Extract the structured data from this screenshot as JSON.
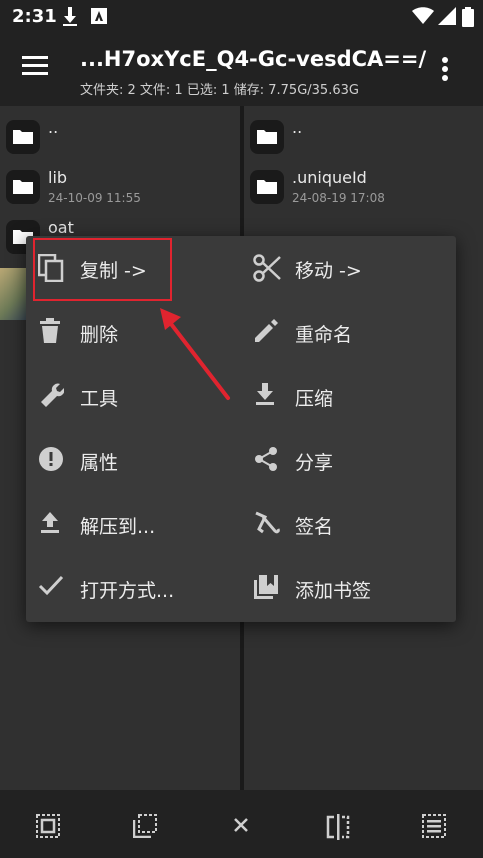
{
  "status_bar": {
    "time": "2:31",
    "icons": [
      "download-icon",
      "app-notification-icon",
      "wifi-icon",
      "signal-icon",
      "battery-icon"
    ]
  },
  "app_bar": {
    "title": "...H7oxYcE_Q4-Gc-vesdCA==/",
    "subtitle": "文件夹: 2  文件: 1  已选: 1  储存: 7.75G/35.63G",
    "icons": [
      "menu-icon",
      "more-vert-icon"
    ]
  },
  "left_pane": {
    "items": [
      {
        "name": "..",
        "date": ""
      },
      {
        "name": "lib",
        "date": "24-10-09 11:55"
      },
      {
        "name": "oat",
        "date": ""
      }
    ]
  },
  "right_pane": {
    "items": [
      {
        "name": "..",
        "date": ""
      },
      {
        "name": ".uniqueId",
        "date": "24-08-19 17:08"
      }
    ]
  },
  "context_menu": {
    "left": [
      {
        "label": "复制 ->",
        "icon": "copy-icon"
      },
      {
        "label": "删除",
        "icon": "delete-icon"
      },
      {
        "label": "工具",
        "icon": "wrench-icon"
      },
      {
        "label": "属性",
        "icon": "info-icon"
      },
      {
        "label": "解压到...",
        "icon": "upload-icon"
      },
      {
        "label": "打开方式...",
        "icon": "check-icon"
      }
    ],
    "right": [
      {
        "label": "移动 ->",
        "icon": "cut-icon"
      },
      {
        "label": "重命名",
        "icon": "edit-icon"
      },
      {
        "label": "压缩",
        "icon": "download-icon"
      },
      {
        "label": "分享",
        "icon": "share-icon"
      },
      {
        "label": "签名",
        "icon": "signature-icon"
      },
      {
        "label": "添加书签",
        "icon": "bookmark-icon"
      }
    ]
  },
  "bottom_bar": {
    "icons": [
      "select-all-icon",
      "select-none-icon",
      "close-icon",
      "split-view-icon",
      "list-view-icon"
    ]
  },
  "colors": {
    "highlight": "#e0242f",
    "menu_bg": "#3a3a3a",
    "pane_bg": "#303030"
  }
}
